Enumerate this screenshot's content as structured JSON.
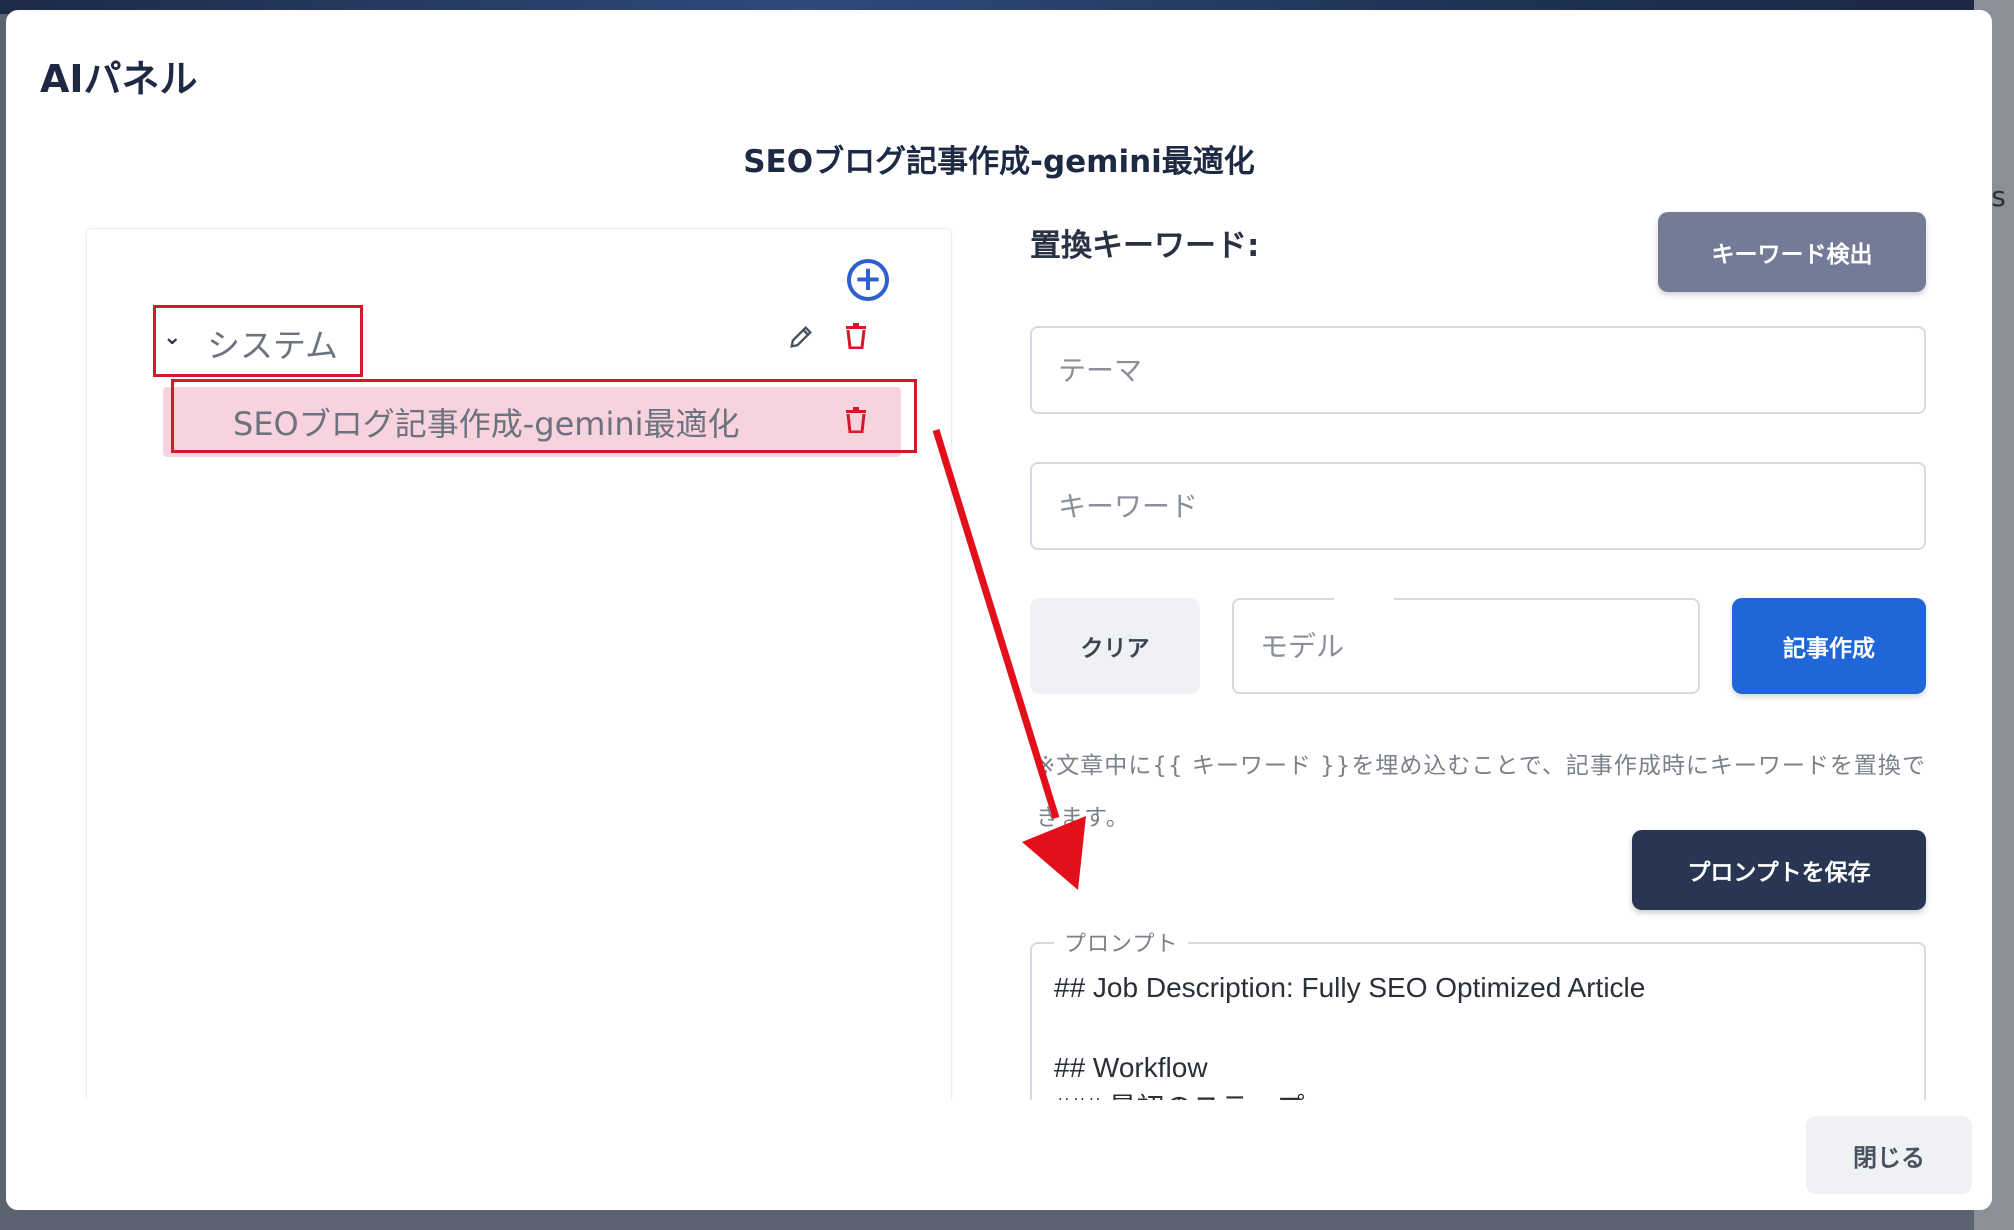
{
  "modal": {
    "title": "AIパネル",
    "heading": "SEOブログ記事作成-gemini最適化"
  },
  "tree": {
    "folder_label": "システム",
    "item_label": "SEOブログ記事作成-gemini最適化",
    "icons": {
      "add": "plus-circle-icon",
      "expand": "chevron-down-icon",
      "edit": "pencil-icon",
      "delete": "trash-icon"
    }
  },
  "form": {
    "keyword_label": "置換キーワード:",
    "detect_button": "キーワード検出",
    "theme_placeholder": "テーマ",
    "keyword_placeholder": "キーワード",
    "clear_button": "クリア",
    "model_placeholder": "モデル",
    "create_button": "記事作成",
    "note": "※文章中に{{ キーワード }}を埋め込むことで、記事作成時にキーワードを置換できます。",
    "save_button": "プロンプトを保存",
    "prompt_legend": "プロンプト",
    "prompt_text": "## Job Description: Fully SEO Optimized Article\n\n## Workflow\n### 最初のステップ"
  },
  "footer": {
    "close_button": "閉じる"
  },
  "colors": {
    "highlight_border": "#d11a2a",
    "annotation_arrow": "#e3101c",
    "primary": "#2066d8",
    "dark": "#283654",
    "selected_item_bg": "#f8d3dd"
  },
  "background_peek": "es"
}
